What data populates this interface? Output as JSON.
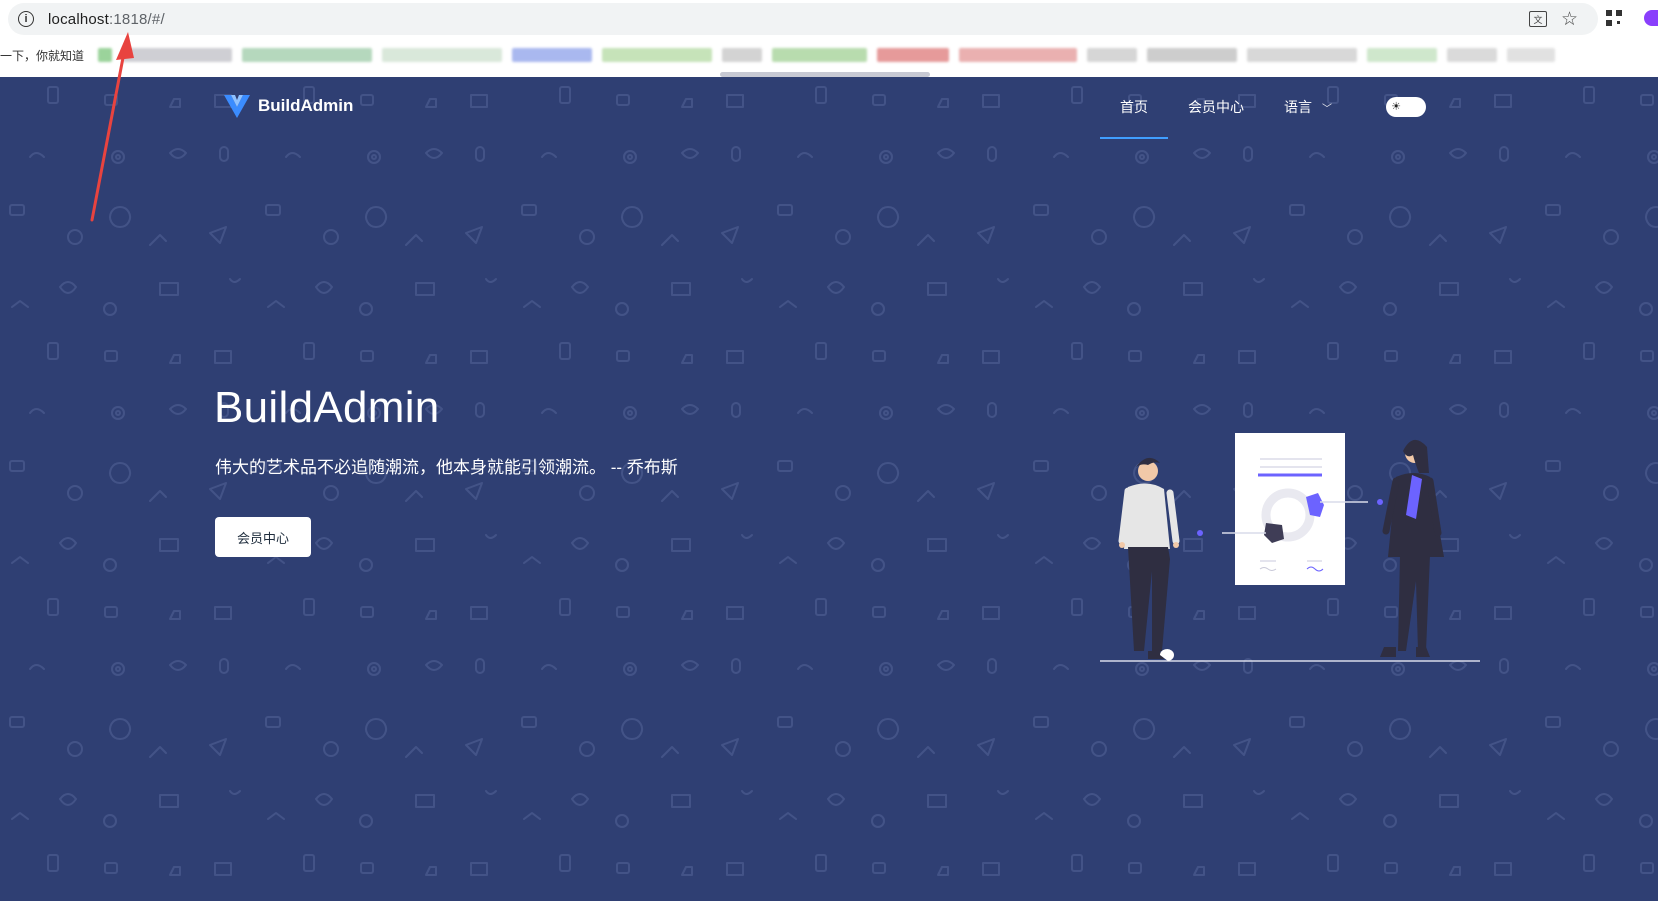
{
  "browser": {
    "url_host": "localhost",
    "url_rest": ":1818/#/",
    "bookmark_text": "一下，你就知道"
  },
  "nav": {
    "logo_text": "BuildAdmin",
    "items": [
      {
        "label": "首页",
        "active": true
      },
      {
        "label": "会员中心",
        "active": false
      },
      {
        "label": "语言",
        "active": false
      }
    ]
  },
  "hero": {
    "title": "BuildAdmin",
    "quote": "伟大的艺术品不必追随潮流，他本身就能引领潮流。 -- 乔布斯",
    "button_label": "会员中心"
  },
  "theme": {
    "background": "#2f3f73",
    "accent": "#409eff",
    "illustration_accent": "#6c63ff",
    "annotation_arrow": "#e8433f"
  }
}
